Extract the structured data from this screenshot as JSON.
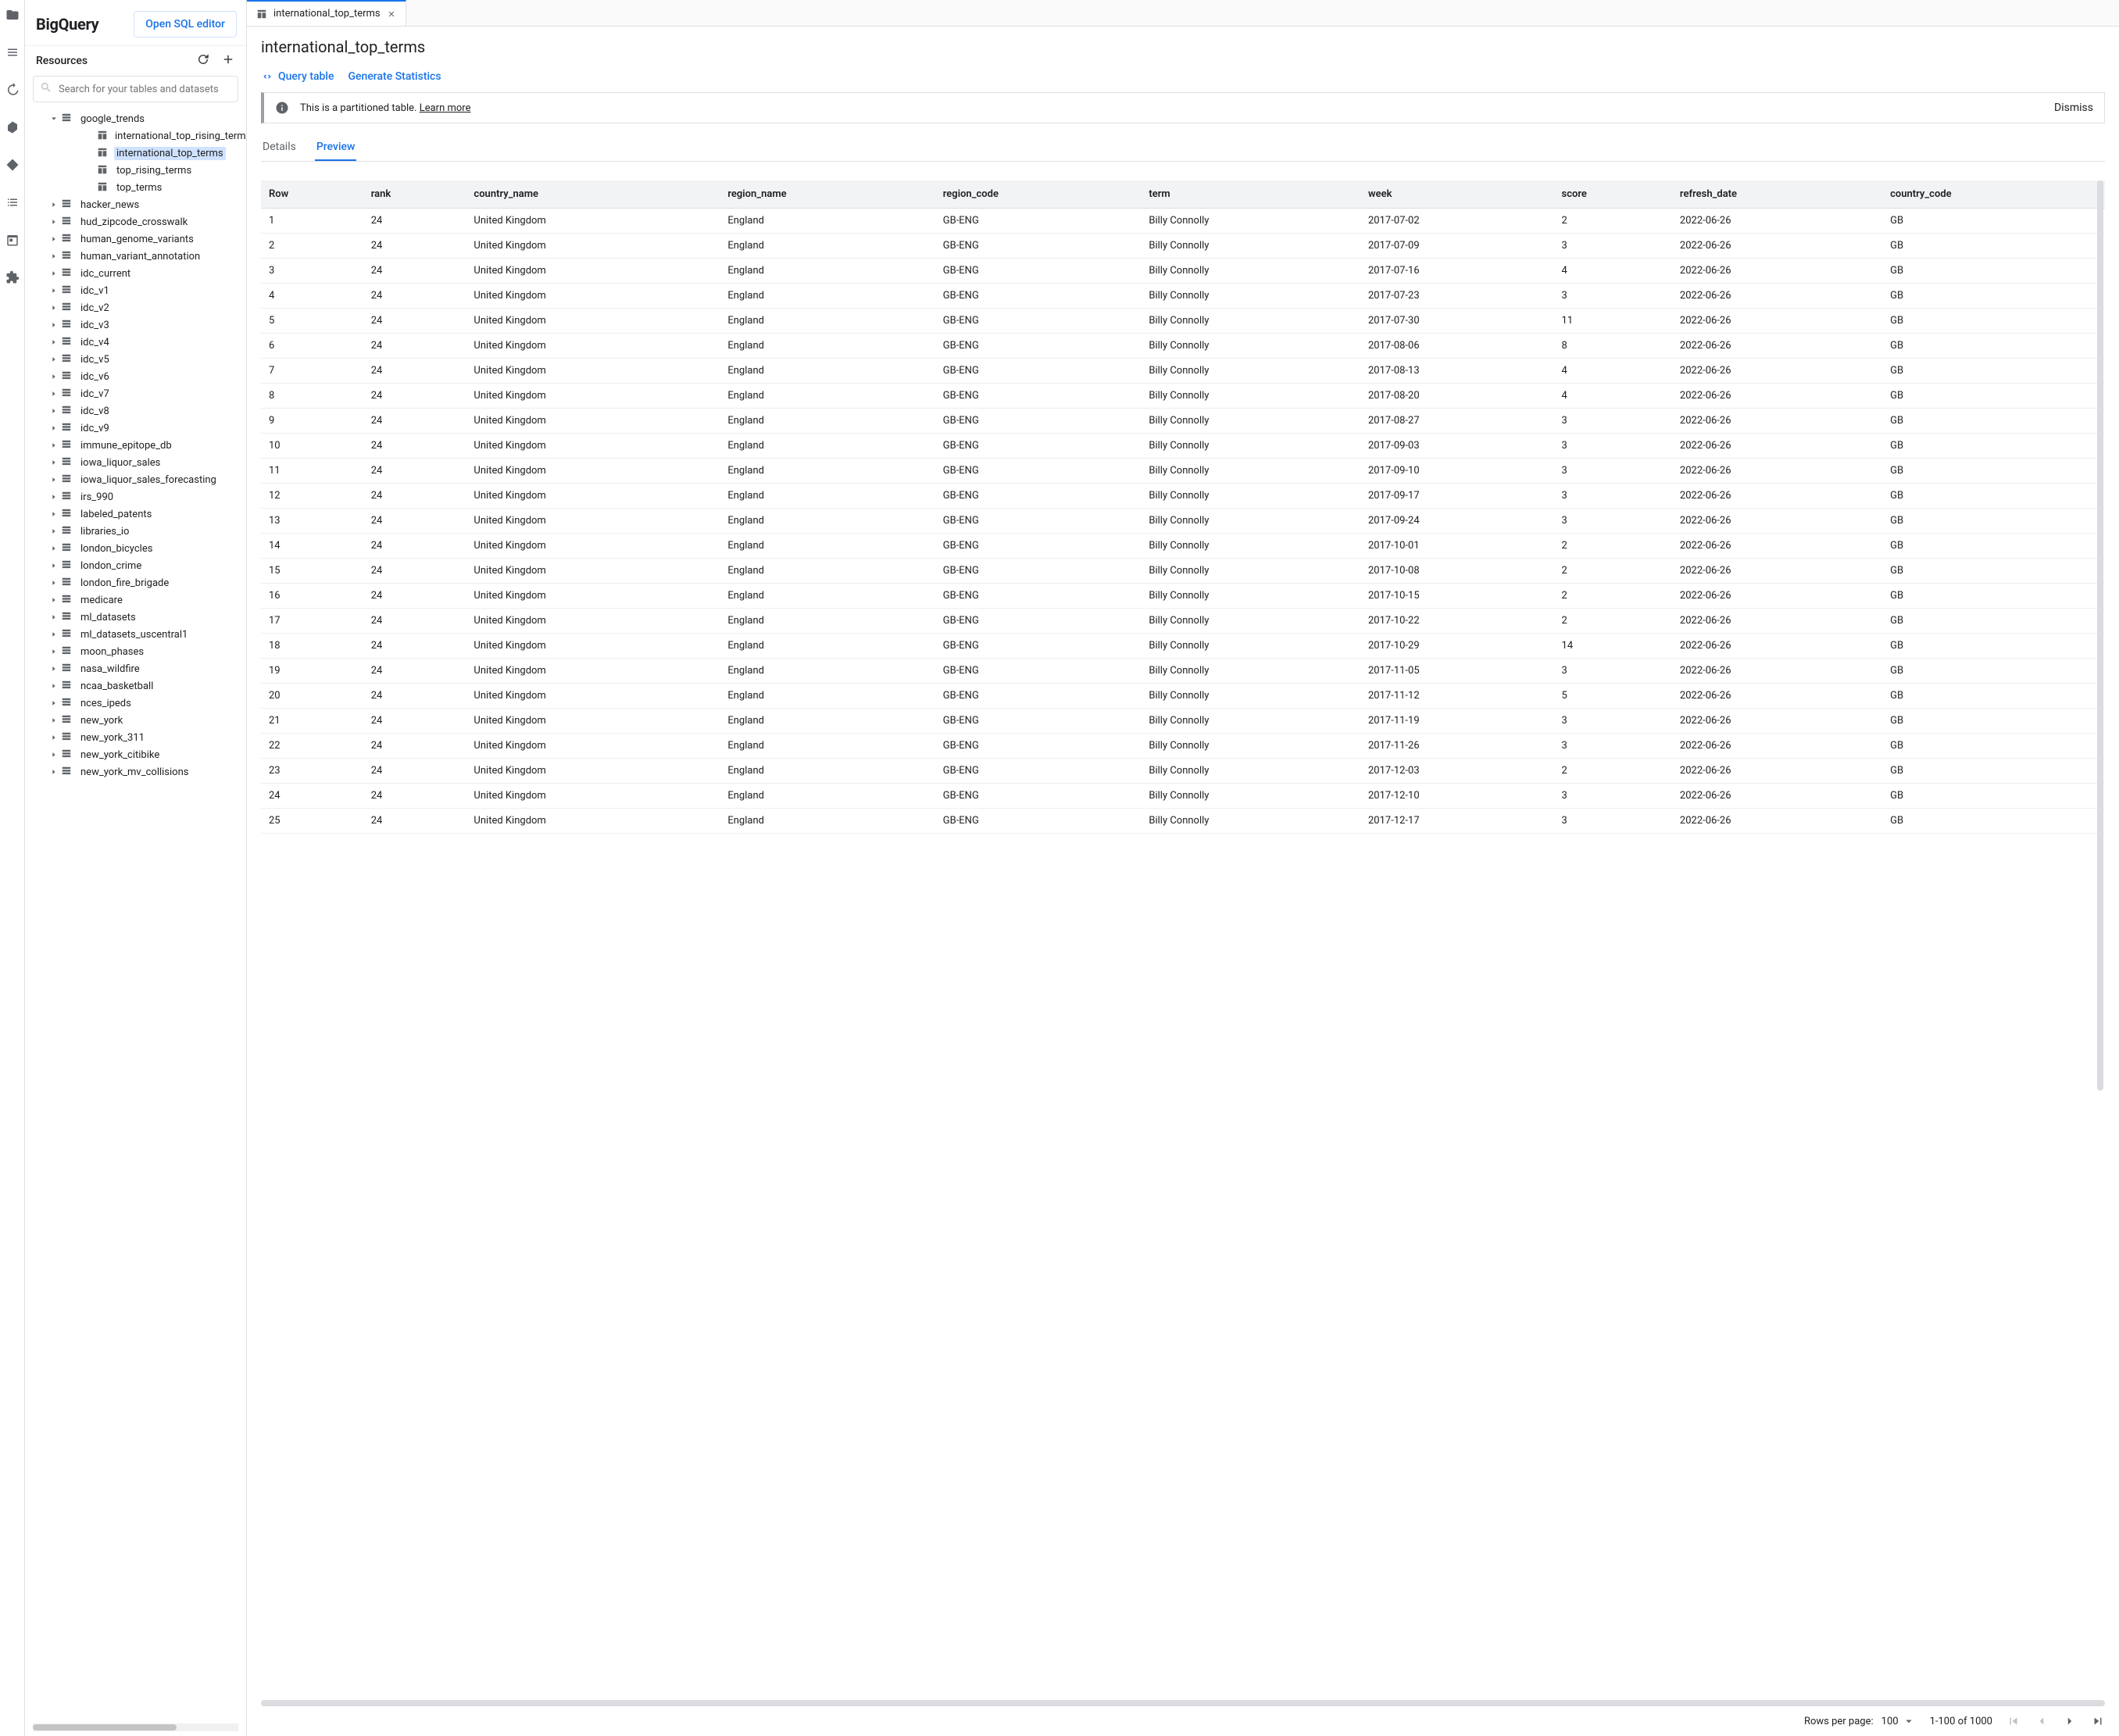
{
  "header": {
    "logo": "BigQuery",
    "open_sql": "Open SQL editor"
  },
  "resources": {
    "title": "Resources",
    "search_placeholder": "Search for your tables and datasets",
    "expanded_dataset": "google_trends",
    "tables_in_expanded": [
      {
        "name": "international_top_rising_terms",
        "selected": false
      },
      {
        "name": "international_top_terms",
        "selected": true
      },
      {
        "name": "top_rising_terms",
        "selected": false
      },
      {
        "name": "top_terms",
        "selected": false
      }
    ],
    "datasets": [
      "hacker_news",
      "hud_zipcode_crosswalk",
      "human_genome_variants",
      "human_variant_annotation",
      "idc_current",
      "idc_v1",
      "idc_v2",
      "idc_v3",
      "idc_v4",
      "idc_v5",
      "idc_v6",
      "idc_v7",
      "idc_v8",
      "idc_v9",
      "immune_epitope_db",
      "iowa_liquor_sales",
      "iowa_liquor_sales_forecasting",
      "irs_990",
      "labeled_patents",
      "libraries_io",
      "london_bicycles",
      "london_crime",
      "london_fire_brigade",
      "medicare",
      "ml_datasets",
      "ml_datasets_uscentral1",
      "moon_phases",
      "nasa_wildfire",
      "ncaa_basketball",
      "nces_ipeds",
      "new_york",
      "new_york_311",
      "new_york_citibike",
      "new_york_mv_collisions"
    ]
  },
  "tab": {
    "label": "international_top_terms"
  },
  "page_title": "international_top_terms",
  "actions": {
    "query": "Query table",
    "stats": "Generate Statistics"
  },
  "banner": {
    "text": "This is a partitioned table. ",
    "link": "Learn more",
    "dismiss": "Dismiss"
  },
  "subtabs": {
    "details": "Details",
    "preview": "Preview"
  },
  "columns": [
    "Row",
    "rank",
    "country_name",
    "region_name",
    "region_code",
    "term",
    "week",
    "score",
    "refresh_date",
    "country_code"
  ],
  "rows": [
    {
      "Row": "1",
      "rank": "24",
      "country_name": "United Kingdom",
      "region_name": "England",
      "region_code": "GB-ENG",
      "term": "Billy Connolly",
      "week": "2017-07-02",
      "score": "2",
      "refresh_date": "2022-06-26",
      "country_code": "GB"
    },
    {
      "Row": "2",
      "rank": "24",
      "country_name": "United Kingdom",
      "region_name": "England",
      "region_code": "GB-ENG",
      "term": "Billy Connolly",
      "week": "2017-07-09",
      "score": "3",
      "refresh_date": "2022-06-26",
      "country_code": "GB"
    },
    {
      "Row": "3",
      "rank": "24",
      "country_name": "United Kingdom",
      "region_name": "England",
      "region_code": "GB-ENG",
      "term": "Billy Connolly",
      "week": "2017-07-16",
      "score": "4",
      "refresh_date": "2022-06-26",
      "country_code": "GB"
    },
    {
      "Row": "4",
      "rank": "24",
      "country_name": "United Kingdom",
      "region_name": "England",
      "region_code": "GB-ENG",
      "term": "Billy Connolly",
      "week": "2017-07-23",
      "score": "3",
      "refresh_date": "2022-06-26",
      "country_code": "GB"
    },
    {
      "Row": "5",
      "rank": "24",
      "country_name": "United Kingdom",
      "region_name": "England",
      "region_code": "GB-ENG",
      "term": "Billy Connolly",
      "week": "2017-07-30",
      "score": "11",
      "refresh_date": "2022-06-26",
      "country_code": "GB"
    },
    {
      "Row": "6",
      "rank": "24",
      "country_name": "United Kingdom",
      "region_name": "England",
      "region_code": "GB-ENG",
      "term": "Billy Connolly",
      "week": "2017-08-06",
      "score": "8",
      "refresh_date": "2022-06-26",
      "country_code": "GB"
    },
    {
      "Row": "7",
      "rank": "24",
      "country_name": "United Kingdom",
      "region_name": "England",
      "region_code": "GB-ENG",
      "term": "Billy Connolly",
      "week": "2017-08-13",
      "score": "4",
      "refresh_date": "2022-06-26",
      "country_code": "GB"
    },
    {
      "Row": "8",
      "rank": "24",
      "country_name": "United Kingdom",
      "region_name": "England",
      "region_code": "GB-ENG",
      "term": "Billy Connolly",
      "week": "2017-08-20",
      "score": "4",
      "refresh_date": "2022-06-26",
      "country_code": "GB"
    },
    {
      "Row": "9",
      "rank": "24",
      "country_name": "United Kingdom",
      "region_name": "England",
      "region_code": "GB-ENG",
      "term": "Billy Connolly",
      "week": "2017-08-27",
      "score": "3",
      "refresh_date": "2022-06-26",
      "country_code": "GB"
    },
    {
      "Row": "10",
      "rank": "24",
      "country_name": "United Kingdom",
      "region_name": "England",
      "region_code": "GB-ENG",
      "term": "Billy Connolly",
      "week": "2017-09-03",
      "score": "3",
      "refresh_date": "2022-06-26",
      "country_code": "GB"
    },
    {
      "Row": "11",
      "rank": "24",
      "country_name": "United Kingdom",
      "region_name": "England",
      "region_code": "GB-ENG",
      "term": "Billy Connolly",
      "week": "2017-09-10",
      "score": "3",
      "refresh_date": "2022-06-26",
      "country_code": "GB"
    },
    {
      "Row": "12",
      "rank": "24",
      "country_name": "United Kingdom",
      "region_name": "England",
      "region_code": "GB-ENG",
      "term": "Billy Connolly",
      "week": "2017-09-17",
      "score": "3",
      "refresh_date": "2022-06-26",
      "country_code": "GB"
    },
    {
      "Row": "13",
      "rank": "24",
      "country_name": "United Kingdom",
      "region_name": "England",
      "region_code": "GB-ENG",
      "term": "Billy Connolly",
      "week": "2017-09-24",
      "score": "3",
      "refresh_date": "2022-06-26",
      "country_code": "GB"
    },
    {
      "Row": "14",
      "rank": "24",
      "country_name": "United Kingdom",
      "region_name": "England",
      "region_code": "GB-ENG",
      "term": "Billy Connolly",
      "week": "2017-10-01",
      "score": "2",
      "refresh_date": "2022-06-26",
      "country_code": "GB"
    },
    {
      "Row": "15",
      "rank": "24",
      "country_name": "United Kingdom",
      "region_name": "England",
      "region_code": "GB-ENG",
      "term": "Billy Connolly",
      "week": "2017-10-08",
      "score": "2",
      "refresh_date": "2022-06-26",
      "country_code": "GB"
    },
    {
      "Row": "16",
      "rank": "24",
      "country_name": "United Kingdom",
      "region_name": "England",
      "region_code": "GB-ENG",
      "term": "Billy Connolly",
      "week": "2017-10-15",
      "score": "2",
      "refresh_date": "2022-06-26",
      "country_code": "GB"
    },
    {
      "Row": "17",
      "rank": "24",
      "country_name": "United Kingdom",
      "region_name": "England",
      "region_code": "GB-ENG",
      "term": "Billy Connolly",
      "week": "2017-10-22",
      "score": "2",
      "refresh_date": "2022-06-26",
      "country_code": "GB"
    },
    {
      "Row": "18",
      "rank": "24",
      "country_name": "United Kingdom",
      "region_name": "England",
      "region_code": "GB-ENG",
      "term": "Billy Connolly",
      "week": "2017-10-29",
      "score": "14",
      "refresh_date": "2022-06-26",
      "country_code": "GB"
    },
    {
      "Row": "19",
      "rank": "24",
      "country_name": "United Kingdom",
      "region_name": "England",
      "region_code": "GB-ENG",
      "term": "Billy Connolly",
      "week": "2017-11-05",
      "score": "3",
      "refresh_date": "2022-06-26",
      "country_code": "GB"
    },
    {
      "Row": "20",
      "rank": "24",
      "country_name": "United Kingdom",
      "region_name": "England",
      "region_code": "GB-ENG",
      "term": "Billy Connolly",
      "week": "2017-11-12",
      "score": "5",
      "refresh_date": "2022-06-26",
      "country_code": "GB"
    },
    {
      "Row": "21",
      "rank": "24",
      "country_name": "United Kingdom",
      "region_name": "England",
      "region_code": "GB-ENG",
      "term": "Billy Connolly",
      "week": "2017-11-19",
      "score": "3",
      "refresh_date": "2022-06-26",
      "country_code": "GB"
    },
    {
      "Row": "22",
      "rank": "24",
      "country_name": "United Kingdom",
      "region_name": "England",
      "region_code": "GB-ENG",
      "term": "Billy Connolly",
      "week": "2017-11-26",
      "score": "3",
      "refresh_date": "2022-06-26",
      "country_code": "GB"
    },
    {
      "Row": "23",
      "rank": "24",
      "country_name": "United Kingdom",
      "region_name": "England",
      "region_code": "GB-ENG",
      "term": "Billy Connolly",
      "week": "2017-12-03",
      "score": "2",
      "refresh_date": "2022-06-26",
      "country_code": "GB"
    },
    {
      "Row": "24",
      "rank": "24",
      "country_name": "United Kingdom",
      "region_name": "England",
      "region_code": "GB-ENG",
      "term": "Billy Connolly",
      "week": "2017-12-10",
      "score": "3",
      "refresh_date": "2022-06-26",
      "country_code": "GB"
    },
    {
      "Row": "25",
      "rank": "24",
      "country_name": "United Kingdom",
      "region_name": "England",
      "region_code": "GB-ENG",
      "term": "Billy Connolly",
      "week": "2017-12-17",
      "score": "3",
      "refresh_date": "2022-06-26",
      "country_code": "GB"
    }
  ],
  "pager": {
    "rpp_label": "Rows per page:",
    "rpp_value": "100",
    "range": "1-100 of 1000"
  }
}
